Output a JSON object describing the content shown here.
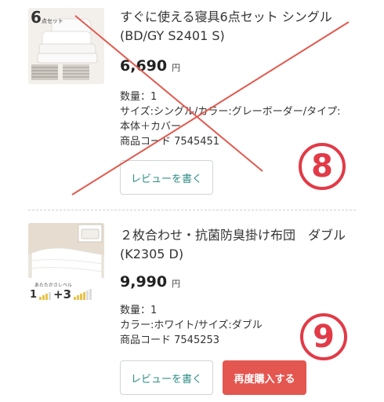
{
  "colors": {
    "accent_red": "#e45650",
    "mark_red": "#e23a47",
    "review_text": "#2f8f86"
  },
  "items": [
    {
      "badge_number": "6",
      "badge_label": "点セット",
      "title": "すぐに使える寝具6点セット シングル (BD/GY S2401 S)",
      "price": "6,690",
      "currency": "円",
      "quantity": "数量：1",
      "attrs": "サイズ:シングル/カラー:グレーボーダー/タイプ:",
      "attrs_cont": "本体＋カバー",
      "code": "商品コード 7545451",
      "review_button": "レビューを書く",
      "annotation": "⑧",
      "crossed_out": true
    },
    {
      "warm_label": "あたたかさレベル",
      "warm_level_min": "1",
      "warm_level_plus": "+3",
      "title": "２枚合わせ・抗菌防臭掛け布団　ダブル (K2305 D)",
      "price": "9,990",
      "currency": "円",
      "quantity": "数量：1",
      "attrs": "カラー:ホワイト/サイズ:ダブル",
      "code": "商品コード 7545253",
      "review_button": "レビューを書く",
      "rebuy_button": "再度購入する",
      "annotation": "⑨"
    }
  ]
}
